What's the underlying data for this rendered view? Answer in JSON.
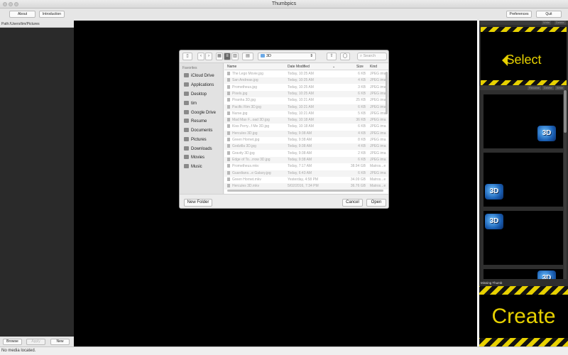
{
  "window": {
    "title": "Thumbpics"
  },
  "toolbar": {
    "about": "About",
    "introduction": "Introduction",
    "preferences": "Preferences",
    "quit": "Quit"
  },
  "left_panel": {
    "path": "Path:/Users/tim/Pictures",
    "browse": "Browse",
    "apply": "Apply",
    "new": "New"
  },
  "right_panel": {
    "top_tabs": [
      "Write",
      "Delete"
    ],
    "mid_tabs": [
      "Rename",
      "Delete",
      "Write"
    ],
    "select_text": "Select",
    "missing_label": "Missing Thumb",
    "create_text": "Create",
    "badge_text": "3D"
  },
  "status": "No media located.",
  "dialog": {
    "location": "3D",
    "search_placeholder": "Search",
    "favorites_header": "Favorites",
    "sidebar": [
      "iCloud Drive",
      "Applications",
      "Desktop",
      "tim",
      "Google Drive",
      "Resume",
      "Documents",
      "Pictures",
      "Downloads",
      "Movies",
      "Music"
    ],
    "columns": {
      "name": "Name",
      "date": "Date Modified",
      "size": "Size",
      "kind": "Kind"
    },
    "files": [
      {
        "name": "The Lego Movie.jpg",
        "date": "Today, 10:25 AM",
        "size": "6 KB",
        "kind": "JPEG ima"
      },
      {
        "name": "San Andreas.jpg",
        "date": "Today, 10:25 AM",
        "size": "4 KB",
        "kind": "JPEG ima"
      },
      {
        "name": "Prometheus.jpg",
        "date": "Today, 10:25 AM",
        "size": "3 KB",
        "kind": "JPEG ima"
      },
      {
        "name": "Pixels.jpg",
        "date": "Today, 10:25 AM",
        "size": "6 KB",
        "kind": "JPEG ima"
      },
      {
        "name": "Piranha 3D.jpg",
        "date": "Today, 10:21 AM",
        "size": "25 KB",
        "kind": "JPEG ima"
      },
      {
        "name": "Pacific Rim 3D.jpg",
        "date": "Today, 10:21 AM",
        "size": "6 KB",
        "kind": "JPEG ima"
      },
      {
        "name": "Nurse.jpg",
        "date": "Today, 10:21 AM",
        "size": "5 KB",
        "kind": "JPEG ima"
      },
      {
        "name": "Mad Max F...oad 3D.jpg",
        "date": "Today, 10:18 AM",
        "size": "36 KB",
        "kind": "JPEG ima"
      },
      {
        "name": "Kiss Perry...f Me 3D.jpg",
        "date": "Today, 10:18 AM",
        "size": "6 KB",
        "kind": "JPEG ima"
      },
      {
        "name": "Hercules 3D.jpg",
        "date": "Today, 9:38 AM",
        "size": "4 KB",
        "kind": "JPEG ima"
      },
      {
        "name": "Green Hornet.jpg",
        "date": "Today, 9:38 AM",
        "size": "8 KB",
        "kind": "JPEG ima"
      },
      {
        "name": "Godzilla 3D.jpg",
        "date": "Today, 9:38 AM",
        "size": "4 KB",
        "kind": "JPEG ima"
      },
      {
        "name": "Gravity 3D.jpg",
        "date": "Today, 9:38 AM",
        "size": "2 KB",
        "kind": "JPEG ima"
      },
      {
        "name": "Edge of To...rrow 3D.jpg",
        "date": "Today, 9:38 AM",
        "size": "6 KB",
        "kind": "JPEG ima"
      },
      {
        "name": "Prometheus.mkv",
        "date": "Today, 7:17 AM",
        "size": "38.94 GB",
        "kind": "Matros...e"
      },
      {
        "name": "Guardians...e Galaxy.jpg",
        "date": "Today, 6:43 AM",
        "size": "6 KB",
        "kind": "JPEG ima"
      },
      {
        "name": "Green Hornet.mkv",
        "date": "Yesterday, 4:58 PM",
        "size": "34.09 GB",
        "kind": "Matros...e"
      },
      {
        "name": "Hercules 3D.mkv",
        "date": "5/02/2016, 7:34 PM",
        "size": "36.76 GB",
        "kind": "Matros...e"
      }
    ],
    "new_folder": "New Folder",
    "cancel": "Cancel",
    "open": "Open"
  }
}
